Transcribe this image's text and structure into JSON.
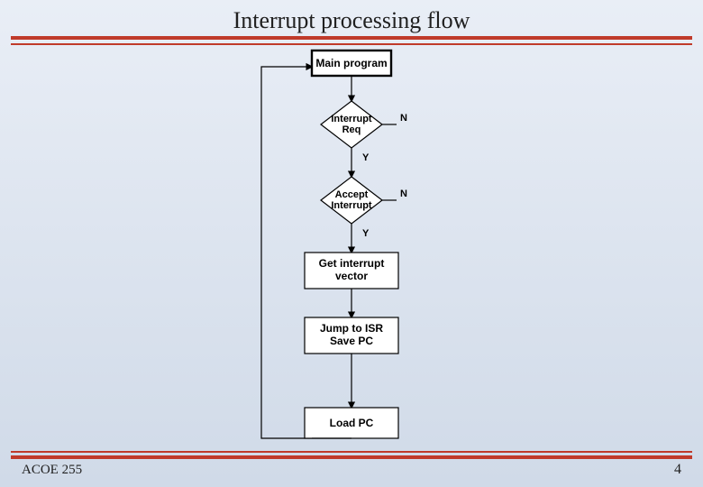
{
  "slide": {
    "title": "Interrupt processing flow",
    "course_code": "ACOE 255",
    "page_number": "4"
  },
  "flow": {
    "nodes": {
      "main_program": "Main program",
      "interrupt_req_l1": "Interrupt",
      "interrupt_req_l2": "Req",
      "accept_interrupt_l1": "Accept",
      "accept_interrupt_l2": "Interrupt",
      "get_interrupt_vector_l1": "Get interrupt",
      "get_interrupt_vector_l2": "vector",
      "jump_to_isr_l1": "Jump to ISR",
      "jump_to_isr_l2": "Save PC",
      "load_pc": "Load PC"
    },
    "labels": {
      "yes": "Y",
      "no": "N"
    }
  }
}
